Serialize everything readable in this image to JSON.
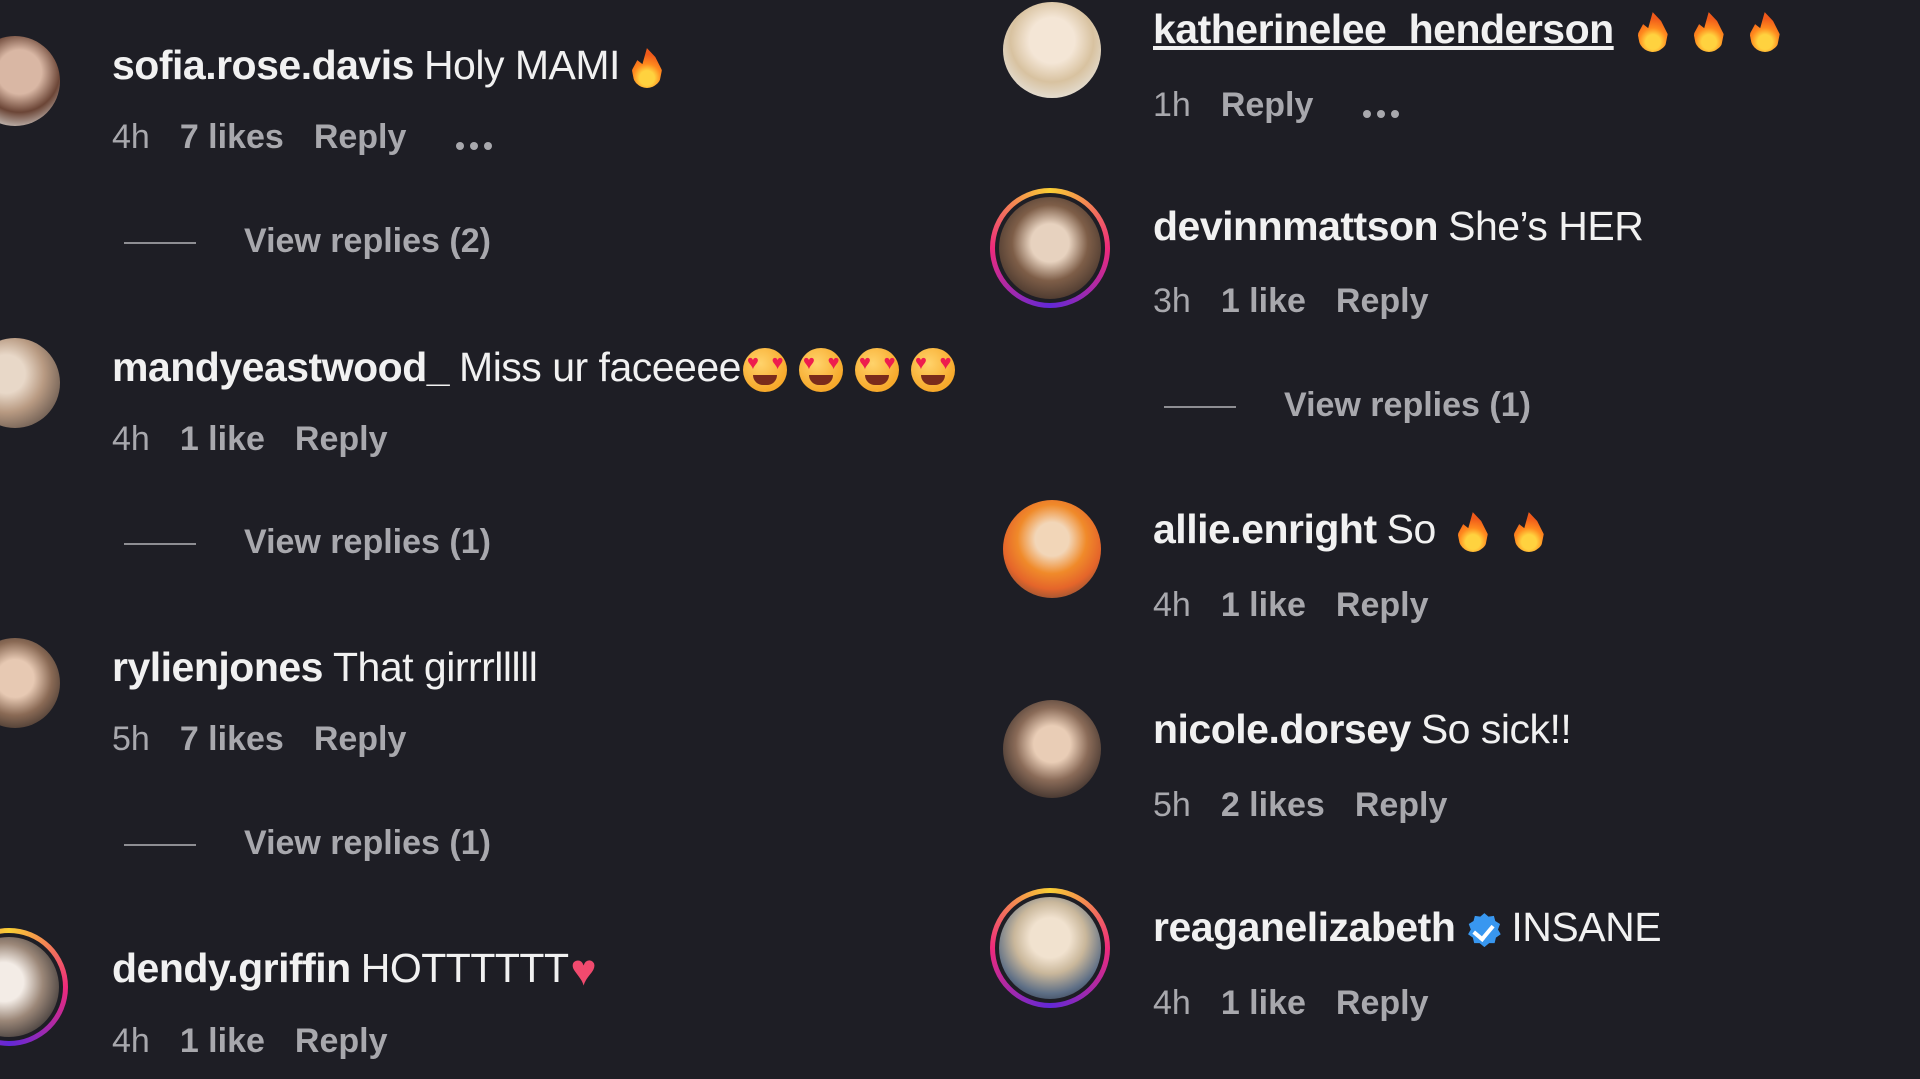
{
  "left_column": {
    "comments": [
      {
        "username": "sofia.rose.davis",
        "text": "Holy MAMI",
        "time": "4h",
        "likes": "7 likes",
        "reply": "Reply",
        "view_replies": "View replies (2)"
      },
      {
        "username": "mandyeastwood_",
        "text": "Miss ur faceeee",
        "time": "4h",
        "likes": "1 like",
        "reply": "Reply",
        "view_replies": "View replies (1)"
      },
      {
        "username": "rylienjones",
        "text": "That girrrlllll",
        "time": "5h",
        "likes": "7 likes",
        "reply": "Reply",
        "view_replies": "View replies (1)"
      },
      {
        "username": "dendy.griffin",
        "text": "HOTTTTTT",
        "time": "4h",
        "likes": "1 like",
        "reply": "Reply"
      }
    ]
  },
  "right_column": {
    "comments": [
      {
        "username": "katherinelee_henderson",
        "time": "1h",
        "reply": "Reply"
      },
      {
        "username": "devinnmattson",
        "text": "She’s HER",
        "time": "3h",
        "likes": "1 like",
        "reply": "Reply",
        "view_replies": "View replies (1)"
      },
      {
        "username": "allie.enright",
        "text": "So",
        "time": "4h",
        "likes": "1 like",
        "reply": "Reply"
      },
      {
        "username": "nicole.dorsey",
        "text": "So sick!!",
        "time": "5h",
        "likes": "2 likes",
        "reply": "Reply"
      },
      {
        "username": "reaganelizabeth",
        "text": "INSANE",
        "time": "4h",
        "likes": "1 like",
        "reply": "Reply",
        "verified_icon": "verified-badge-icon"
      }
    ]
  },
  "colors": {
    "background": "#1e1e25",
    "text_primary": "#f1f1f1",
    "text_secondary": "#a8a8ad",
    "verified": "#3897f0"
  },
  "icons": [
    "fire-emoji-icon",
    "heart-eyes-emoji-icon",
    "heart-emoji-icon",
    "more-options-icon",
    "verified-badge-icon"
  ]
}
